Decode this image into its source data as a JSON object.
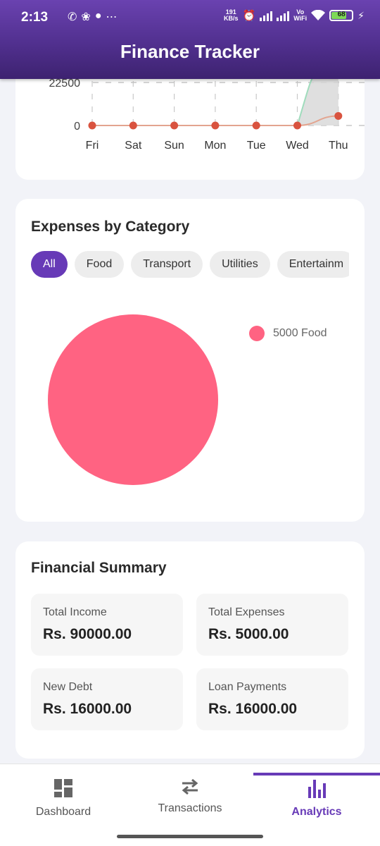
{
  "status_bar": {
    "time": "2:13",
    "speed": "191",
    "speed_unit": "KB/s",
    "vowifi_top": "Vo",
    "vowifi_bottom": "WiFi",
    "battery": "68"
  },
  "header": {
    "title": "Finance Tracker"
  },
  "weekly_chart": {
    "chart_data": {
      "type": "line",
      "categories": [
        "Fri",
        "Sat",
        "Sun",
        "Mon",
        "Tue",
        "Wed",
        "Thu"
      ],
      "visible_y_ticks": [
        "22500",
        "0"
      ],
      "series": [
        {
          "values": [
            0,
            0,
            0,
            0,
            0,
            0,
            5000
          ],
          "color": "#d9533f"
        }
      ],
      "grid": "dashed"
    }
  },
  "categories_card": {
    "title": "Expenses by Category",
    "filters": [
      "All",
      "Food",
      "Transport",
      "Utilities",
      "Entertainm"
    ],
    "active_filter": "All",
    "chart_data": {
      "type": "pie",
      "slices": [
        {
          "label": "Food",
          "value": 5000,
          "color": "#ff6382"
        }
      ],
      "legend": [
        "5000 Food"
      ],
      "legend_position": "top-right"
    }
  },
  "summary": {
    "title": "Financial Summary",
    "items": [
      {
        "label": "Total Income",
        "value": "Rs. 90000.00"
      },
      {
        "label": "Total Expenses",
        "value": "Rs. 5000.00"
      },
      {
        "label": "New Debt",
        "value": "Rs. 16000.00"
      },
      {
        "label": "Loan Payments",
        "value": "Rs. 16000.00"
      }
    ]
  },
  "bottom_nav": {
    "items": [
      {
        "label": "Dashboard",
        "icon": "dashboard-icon"
      },
      {
        "label": "Transactions",
        "icon": "swap-arrows-icon"
      },
      {
        "label": "Analytics",
        "icon": "bar-chart-icon"
      }
    ],
    "active": "Analytics",
    "accent": "#673ab7"
  }
}
